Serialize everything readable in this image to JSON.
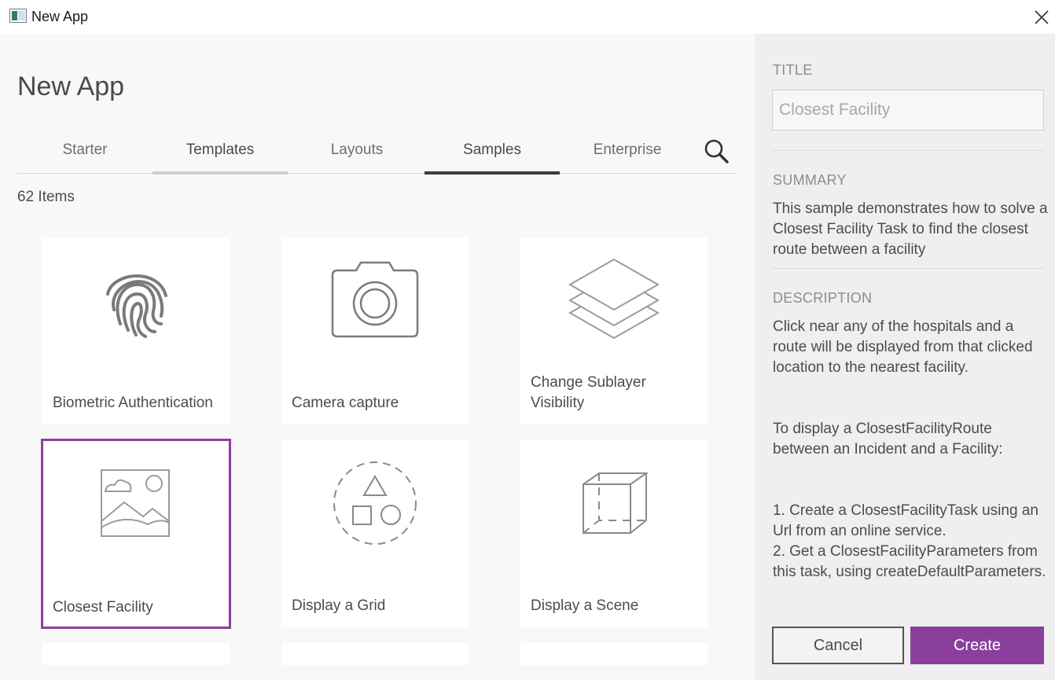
{
  "window": {
    "title": "New App"
  },
  "header": {
    "title": "New App"
  },
  "tabs": [
    {
      "label": "Starter"
    },
    {
      "label": "Templates"
    },
    {
      "label": "Layouts"
    },
    {
      "label": "Samples"
    },
    {
      "label": "Enterprise"
    }
  ],
  "active_tab": "Samples",
  "items_count": "62 Items",
  "cards": [
    {
      "label": "Biometric Authentication",
      "icon": "fingerprint-icon"
    },
    {
      "label": "Camera capture",
      "icon": "camera-icon"
    },
    {
      "label": "Change Sublayer Visibility",
      "icon": "layers-icon"
    },
    {
      "label": "Closest Facility",
      "icon": "image-icon",
      "selected": true
    },
    {
      "label": "Display a Grid",
      "icon": "shapes-grid-icon"
    },
    {
      "label": "Display a Scene",
      "icon": "cube-icon"
    }
  ],
  "details": {
    "title_label": "TITLE",
    "title_value": "Closest Facility",
    "summary_label": "SUMMARY",
    "summary": "This sample demonstrates how to solve a Closest Facility Task to find the closest route between a facility",
    "description_label": "DESCRIPTION",
    "description_p1": "Click near any of the hospitals and a route will be displayed from that clicked location to the nearest facility.",
    "description_p2": "To display a ClosestFacilityRoute between an Incident and a Facility:",
    "description_p3": "1. Create a ClosestFacilityTask using an Url from an online service.\n2. Get a ClosestFacilityParameters from this task, using createDefaultParameters."
  },
  "buttons": {
    "cancel": "Cancel",
    "create": "Create"
  },
  "colors": {
    "accent": "#8a3f9c",
    "panel": "#efefef",
    "background": "#f8f8f8"
  }
}
